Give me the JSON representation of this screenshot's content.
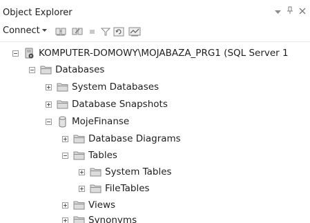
{
  "window": {
    "title": "Object Explorer",
    "controls": {
      "dropdown": "▾",
      "pin": "ꟷ",
      "close": "✕"
    }
  },
  "toolbar": {
    "connect_label": "Connect",
    "connect_arrow": "▾",
    "icons": [
      "connect-object-explorer-icon",
      "disconnect-icon",
      "stop-icon",
      "filter-icon",
      "refresh-icon",
      "activity-monitor-icon"
    ]
  },
  "tree": {
    "server": {
      "label": "KOMPUTER-DOMOWY\\MOJABAZA_PRG1 (SQL Server 1",
      "icon": "server-icon"
    },
    "databases": {
      "label": "Databases",
      "icon": "folder-icon"
    },
    "system_databases": {
      "label": "System Databases",
      "icon": "folder-icon"
    },
    "database_snapshots": {
      "label": "Database Snapshots",
      "icon": "folder-icon"
    },
    "mojefinanse": {
      "label": "MojeFinanse",
      "icon": "database-icon"
    },
    "database_diagrams": {
      "label": "Database Diagrams",
      "icon": "folder-icon"
    },
    "tables": {
      "label": "Tables",
      "icon": "folder-icon"
    },
    "system_tables": {
      "label": "System Tables",
      "icon": "folder-icon"
    },
    "filetables": {
      "label": "FileTables",
      "icon": "folder-icon"
    },
    "views": {
      "label": "Views",
      "icon": "folder-icon"
    },
    "synonyms": {
      "label": "Synonyms",
      "icon": "folder-icon"
    }
  },
  "colors": {
    "folder_fill": "#dcdcdc",
    "folder_stroke": "#8a8a8a",
    "text": "#1e1e1e"
  }
}
